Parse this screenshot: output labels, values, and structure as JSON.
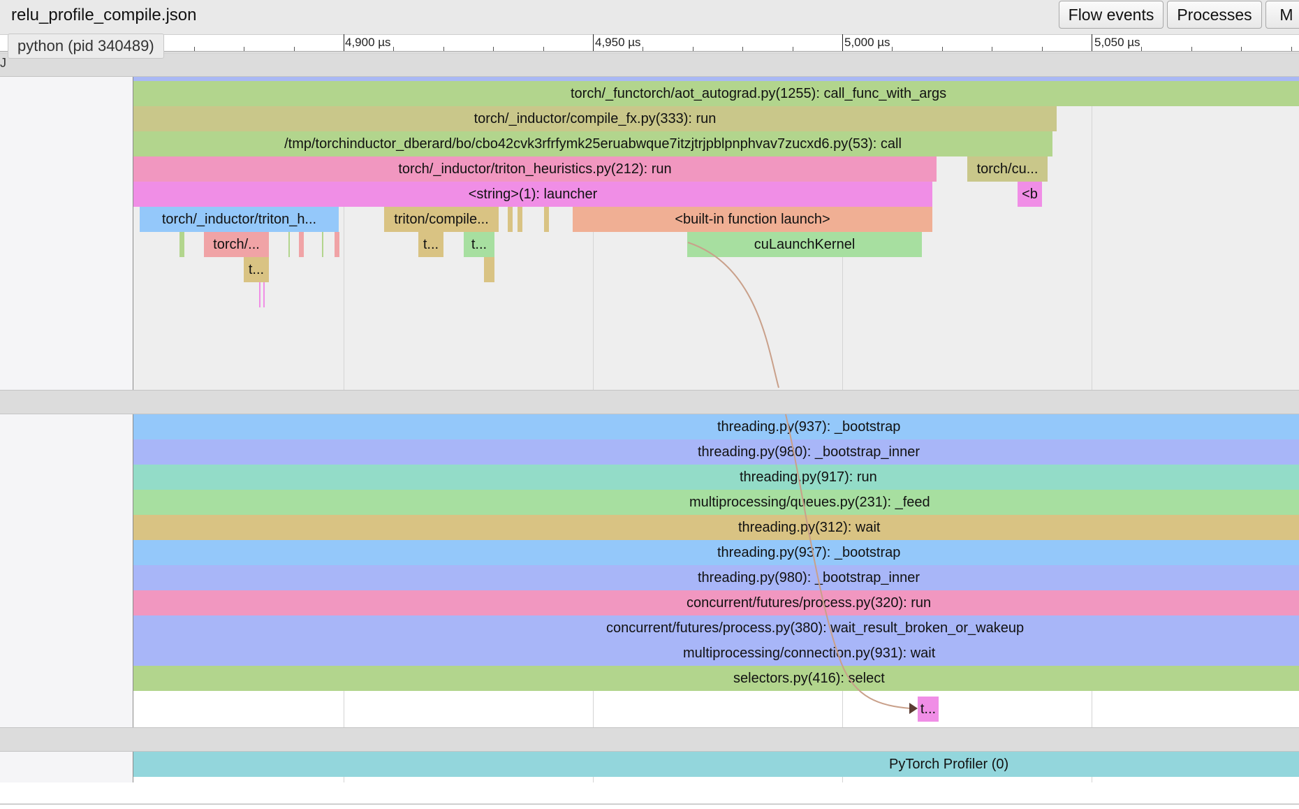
{
  "header": {
    "file_title": "relu_profile_compile.json",
    "buttons": {
      "flow_events": "Flow events",
      "processes": "Processes",
      "more": "M"
    }
  },
  "ruler": {
    "labels": [
      "4,900 µs",
      "4,950 µs",
      "5,000 µs",
      "5,050 µs"
    ]
  },
  "process": {
    "tooltip": "python (pid 340489)",
    "corner_glyph": "J"
  },
  "main_thread": {
    "slices": {
      "top_bar": "",
      "call_func": "torch/_functorch/aot_autograd.py(1255): call_func_with_args",
      "compile_fx_run": "torch/_inductor/compile_fx.py(333): run",
      "tmp_call": "/tmp/torchinductor_dberard/bo/cbo42cvk3rfrfymk25eruabwque7itzjtrjpblpnphvav7zucxd6.py(53): call",
      "heuristics_run": "torch/_inductor/triton_heuristics.py(212): run",
      "torch_cu": "torch/cu...",
      "launcher": "<string>(1): launcher",
      "builtin_b": "<b",
      "triton_h": "torch/_inductor/triton_h...",
      "triton_compile": "triton/compile...",
      "builtin_launch": "<built-in function launch>",
      "torch_dot": "torch/...",
      "t1": "t...",
      "t2": "t...",
      "cu_launch_kernel": "cuLaunchKernel",
      "t3": "t..."
    }
  },
  "worker_thread": {
    "slices": {
      "bootstrap1": "threading.py(937): _bootstrap",
      "bootstrap_inner1": "threading.py(980): _bootstrap_inner",
      "run1": "threading.py(917): run",
      "feed": "multiprocessing/queues.py(231): _feed",
      "wait1": "threading.py(312): wait",
      "bootstrap2": "threading.py(937): _bootstrap",
      "bootstrap_inner2": "threading.py(980): _bootstrap_inner",
      "process_run": "concurrent/futures/process.py(320): run",
      "wait_result": "concurrent/futures/process.py(380): wait_result_broken_or_wakeup",
      "conn_wait": "multiprocessing/connection.py(931): wait",
      "select": "selectors.py(416): select",
      "flow_target": "t..."
    }
  },
  "profiler_track": {
    "label": "PyTorch Profiler (0)"
  },
  "colors": {
    "green": "#b2d58d",
    "khaki": "#c9c78a",
    "pink": "#f197c0",
    "magenta": "#f08ee6",
    "blue": "#94c8fa",
    "tan": "#d9c383",
    "salmon": "#f0af94",
    "red": "#f0a3a6",
    "mint": "#a7dfa0",
    "lav": "#a8b6f8",
    "teal": "#93dcc8",
    "cyan": "#93d6dc",
    "flow": "#c9a08a"
  }
}
